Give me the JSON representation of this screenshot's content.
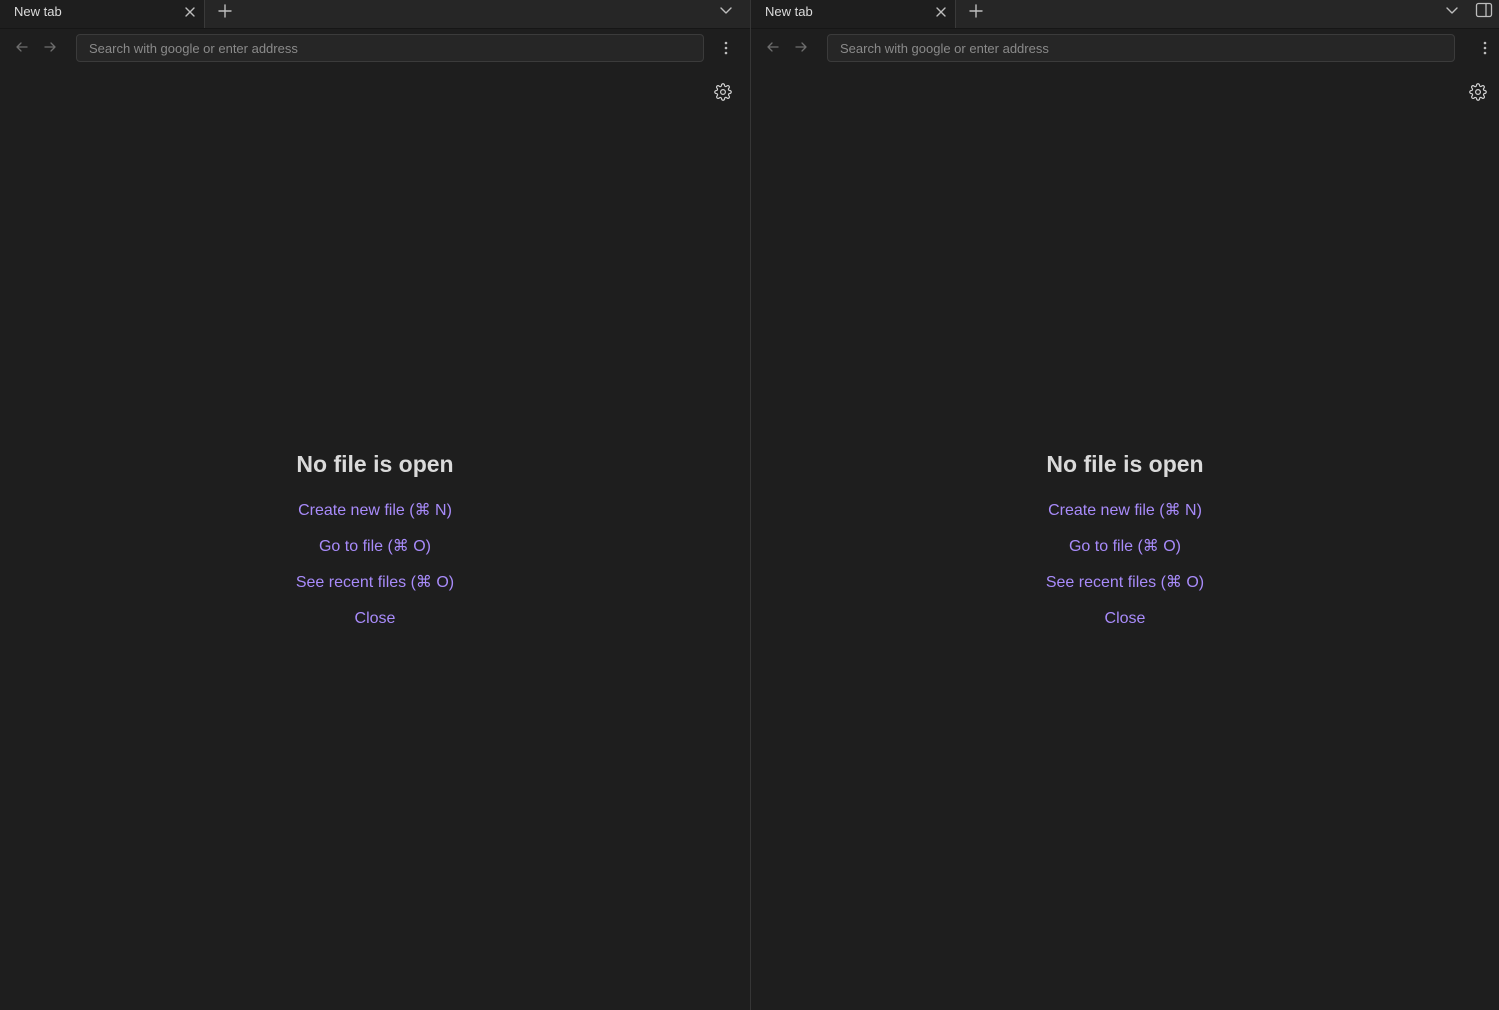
{
  "panes": [
    {
      "tab": {
        "label": "New tab"
      },
      "address_bar": {
        "placeholder": "Search with google or enter address",
        "value": ""
      },
      "empty_state": {
        "title": "No file is open",
        "actions": [
          {
            "label": "Create new file (⌘ N)"
          },
          {
            "label": "Go to file (⌘ O)"
          },
          {
            "label": "See recent files (⌘ O)"
          },
          {
            "label": "Close"
          }
        ]
      }
    },
    {
      "tab": {
        "label": "New tab"
      },
      "address_bar": {
        "placeholder": "Search with google or enter address",
        "value": ""
      },
      "empty_state": {
        "title": "No file is open",
        "actions": [
          {
            "label": "Create new file (⌘ N)"
          },
          {
            "label": "Go to file (⌘ O)"
          },
          {
            "label": "See recent files (⌘ O)"
          },
          {
            "label": "Close"
          }
        ]
      }
    }
  ],
  "icons": {
    "tab_close": "close-icon",
    "new_tab": "plus-icon",
    "tab_list": "chevron-down-icon",
    "back": "arrow-left-icon",
    "forward": "arrow-right-icon",
    "more": "more-vertical-icon",
    "settings": "gear-icon",
    "sidebar_toggle": "sidebar-right-icon"
  },
  "colors": {
    "background": "#1e1e1e",
    "tabbar": "#262626",
    "accent": "#a88bfa",
    "text": "#dadada",
    "icon": "#bdbdbd",
    "icon_muted": "#6e6e6e"
  }
}
